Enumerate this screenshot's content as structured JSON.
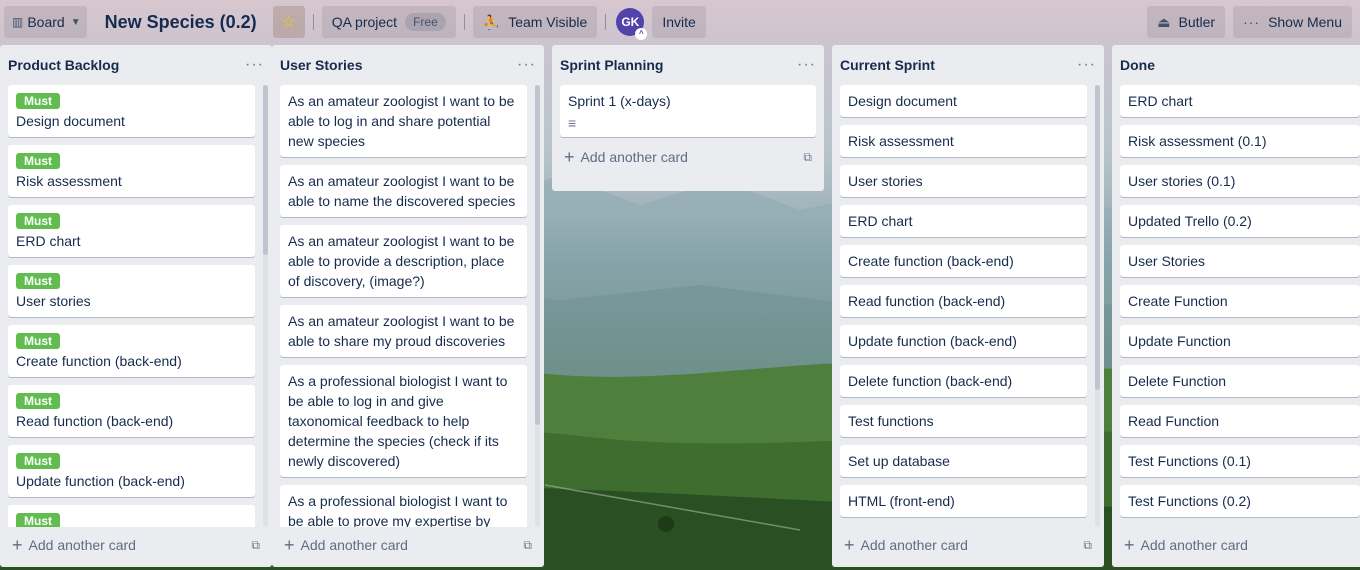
{
  "header": {
    "board_button": "Board",
    "board_title": "New Species (0.2)",
    "workspace_name": "QA project",
    "workspace_badge": "Free",
    "visibility": "Team Visible",
    "avatar_initials": "GK",
    "invite": "Invite",
    "butler": "Butler",
    "show_menu": "Show Menu"
  },
  "colors": {
    "label_must": "#61bd4f",
    "list_bg": "#ebecf0",
    "avatar": "#5243aa"
  },
  "add_card_label": "Add another card",
  "lists": [
    {
      "title": "Product Backlog",
      "cards": [
        {
          "label": "Must",
          "text": "Design document"
        },
        {
          "label": "Must",
          "text": "Risk assessment"
        },
        {
          "label": "Must",
          "text": "ERD chart"
        },
        {
          "label": "Must",
          "text": "User stories"
        },
        {
          "label": "Must",
          "text": "Create function (back-end)"
        },
        {
          "label": "Must",
          "text": "Read function (back-end)"
        },
        {
          "label": "Must",
          "text": "Update function (back-end)"
        },
        {
          "label": "Must",
          "text": ""
        }
      ]
    },
    {
      "title": "User Stories",
      "cards": [
        {
          "text": "As an amateur zoologist I want to be able to log in and share potential new species"
        },
        {
          "text": "As an amateur zoologist I want to be able to name the discovered species"
        },
        {
          "text": "As an amateur zoologist I want to be able to provide a description, place of discovery, (image?)"
        },
        {
          "text": "As an amateur zoologist I want to be able to share my proud discoveries"
        },
        {
          "text": "As a professional biologist I want to be able to log in and give taxonomical feedback to help determine the species (check if its newly discovered)"
        },
        {
          "text": "As a professional biologist I want to be able to prove my expertise by"
        }
      ]
    },
    {
      "title": "Sprint Planning",
      "cards": [
        {
          "text": "Sprint 1 (x-days)",
          "has_description": true
        }
      ]
    },
    {
      "title": "Current Sprint",
      "cards": [
        {
          "text": "Design document"
        },
        {
          "text": "Risk assessment"
        },
        {
          "text": "User stories"
        },
        {
          "text": "ERD chart"
        },
        {
          "text": "Create function (back-end)"
        },
        {
          "text": "Read function (back-end)"
        },
        {
          "text": "Update function (back-end)"
        },
        {
          "text": "Delete function (back-end)"
        },
        {
          "text": "Test functions"
        },
        {
          "text": "Set up database"
        },
        {
          "text": "HTML (front-end)"
        }
      ]
    },
    {
      "title": "Done",
      "cards": [
        {
          "text": "ERD chart"
        },
        {
          "text": "Risk assessment (0.1)"
        },
        {
          "text": "User stories (0.1)"
        },
        {
          "text": "Updated Trello (0.2)"
        },
        {
          "text": "User Stories"
        },
        {
          "text": "Create Function"
        },
        {
          "text": "Update Function"
        },
        {
          "text": "Delete Function"
        },
        {
          "text": "Read Function"
        },
        {
          "text": "Test Functions (0.1)"
        },
        {
          "text": "Test Functions (0.2)"
        }
      ]
    }
  ]
}
